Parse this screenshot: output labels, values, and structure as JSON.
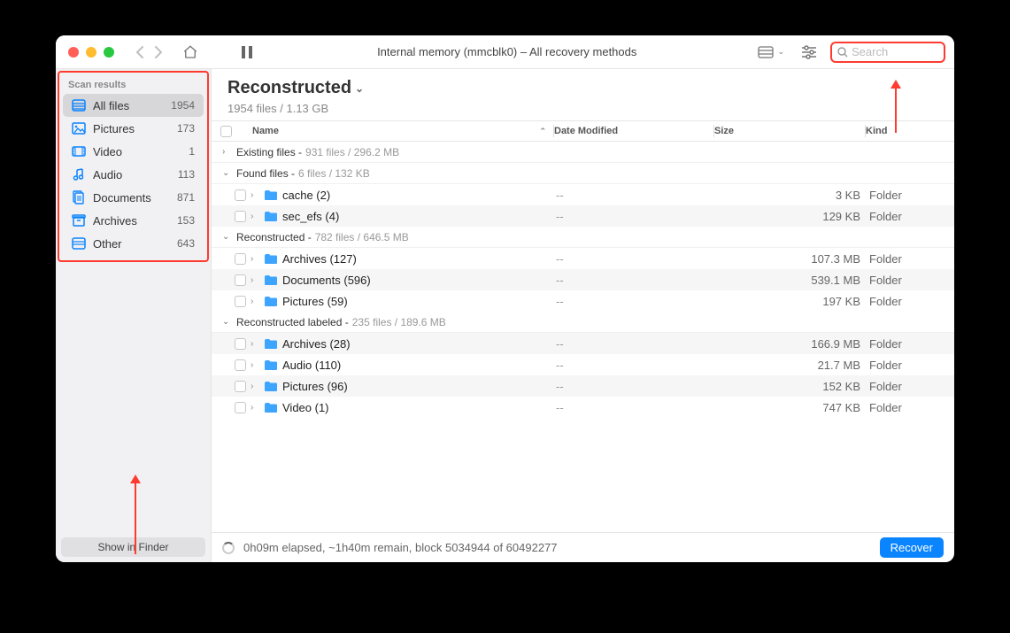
{
  "toolbar": {
    "title": "Internal memory (mmcblk0) – All recovery methods",
    "search_placeholder": "Search"
  },
  "sidebar": {
    "header": "Scan results",
    "items": [
      {
        "icon": "all",
        "label": "All files",
        "count": "1954",
        "selected": true
      },
      {
        "icon": "pictures",
        "label": "Pictures",
        "count": "173",
        "selected": false
      },
      {
        "icon": "video",
        "label": "Video",
        "count": "1",
        "selected": false
      },
      {
        "icon": "audio",
        "label": "Audio",
        "count": "113",
        "selected": false
      },
      {
        "icon": "documents",
        "label": "Documents",
        "count": "871",
        "selected": false
      },
      {
        "icon": "archives",
        "label": "Archives",
        "count": "153",
        "selected": false
      },
      {
        "icon": "other",
        "label": "Other",
        "count": "643",
        "selected": false
      }
    ],
    "show_in_finder": "Show in Finder"
  },
  "main": {
    "title": "Reconstructed",
    "subtitle": "1954 files / 1.13 GB",
    "columns": {
      "name": "Name",
      "date": "Date Modified",
      "size": "Size",
      "kind": "Kind"
    }
  },
  "groups": [
    {
      "name": "Existing files",
      "meta": "931 files / 296.2 MB",
      "expanded": false,
      "rows": []
    },
    {
      "name": "Found files",
      "meta": "6 files / 132 KB",
      "expanded": true,
      "rows": [
        {
          "name": "cache (2)",
          "date": "--",
          "size": "3 KB",
          "kind": "Folder"
        },
        {
          "name": "sec_efs (4)",
          "date": "--",
          "size": "129 KB",
          "kind": "Folder"
        }
      ]
    },
    {
      "name": "Reconstructed",
      "meta": "782 files / 646.5 MB",
      "expanded": true,
      "rows": [
        {
          "name": "Archives (127)",
          "date": "--",
          "size": "107.3 MB",
          "kind": "Folder"
        },
        {
          "name": "Documents (596)",
          "date": "--",
          "size": "539.1 MB",
          "kind": "Folder"
        },
        {
          "name": "Pictures (59)",
          "date": "--",
          "size": "197 KB",
          "kind": "Folder"
        }
      ]
    },
    {
      "name": "Reconstructed labeled",
      "meta": "235 files / 189.6 MB",
      "expanded": true,
      "rows": [
        {
          "name": "Archives (28)",
          "date": "--",
          "size": "166.9 MB",
          "kind": "Folder"
        },
        {
          "name": "Audio (110)",
          "date": "--",
          "size": "21.7 MB",
          "kind": "Folder"
        },
        {
          "name": "Pictures (96)",
          "date": "--",
          "size": "152 KB",
          "kind": "Folder"
        },
        {
          "name": "Video (1)",
          "date": "--",
          "size": "747 KB",
          "kind": "Folder"
        }
      ]
    }
  ],
  "status": {
    "text": "0h09m elapsed, ~1h40m remain, block 5034944 of 60492277",
    "recover_label": "Recover"
  }
}
